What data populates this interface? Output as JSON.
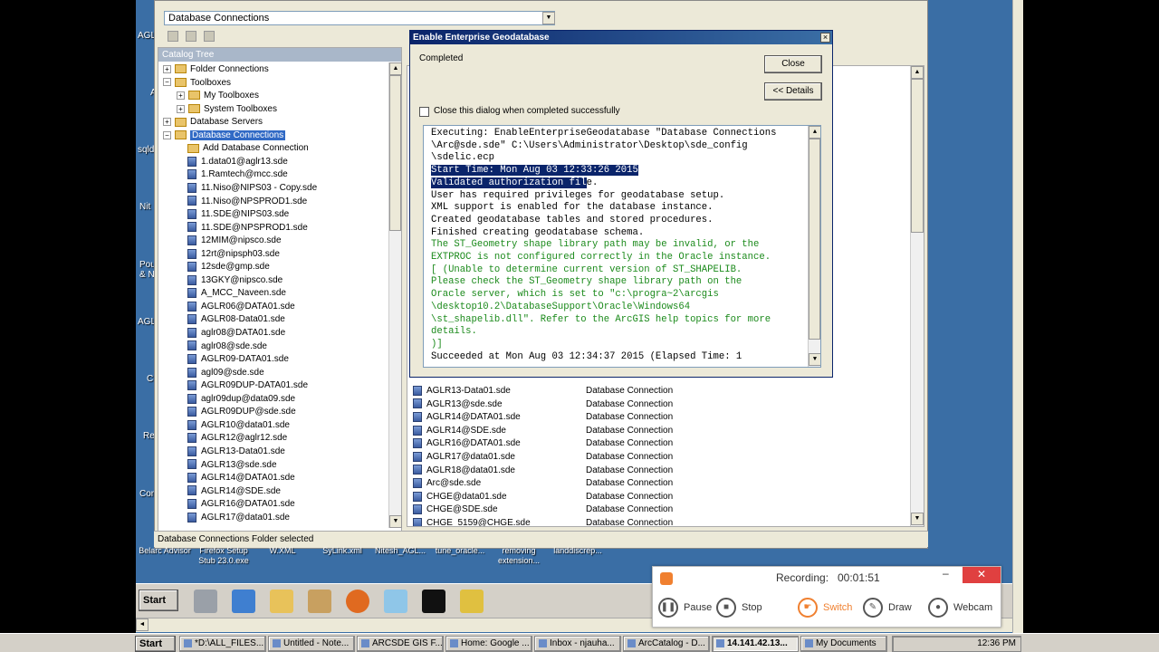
{
  "combo": {
    "location": "Database Connections"
  },
  "desktop_left_labels": [
    "AGL",
    "A",
    "sqld",
    "Nit",
    "Pou",
    "& N",
    "AGL",
    "C",
    "Re",
    "Con"
  ],
  "catalog_tree": {
    "title": "Catalog Tree",
    "nodes": [
      {
        "label": "Folder Connections",
        "level": 0,
        "expander": "+",
        "icon": "folder-icon"
      },
      {
        "label": "Toolboxes",
        "level": 0,
        "expander": "−",
        "icon": "toolbox-icon"
      },
      {
        "label": "My Toolboxes",
        "level": 1,
        "expander": "+",
        "icon": "toolbox-icon"
      },
      {
        "label": "System Toolboxes",
        "level": 1,
        "expander": "+",
        "icon": "toolbox-icon"
      },
      {
        "label": "Database Servers",
        "level": 0,
        "expander": "+",
        "icon": "server-icon"
      },
      {
        "label": "Database Connections",
        "level": 0,
        "expander": "−",
        "icon": "folder-icon",
        "selected": true
      },
      {
        "label": "Add Database Connection",
        "level": 1,
        "icon": "add-connection-icon"
      },
      {
        "label": "1.data01@aglr13.sde",
        "level": 1,
        "icon": "database-icon"
      },
      {
        "label": "1.Ramtech@mcc.sde",
        "level": 1,
        "icon": "database-icon"
      },
      {
        "label": "11.Niso@NIPS03 - Copy.sde",
        "level": 1,
        "icon": "database-icon"
      },
      {
        "label": "11.Niso@NPSPROD1.sde",
        "level": 1,
        "icon": "database-icon"
      },
      {
        "label": "11.SDE@NIPS03.sde",
        "level": 1,
        "icon": "database-icon"
      },
      {
        "label": "11.SDE@NPSPROD1.sde",
        "level": 1,
        "icon": "database-icon"
      },
      {
        "label": "12MIM@nipsco.sde",
        "level": 1,
        "icon": "database-icon"
      },
      {
        "label": "12rt@nipsph03.sde",
        "level": 1,
        "icon": "database-icon"
      },
      {
        "label": "12sde@gmp.sde",
        "level": 1,
        "icon": "database-icon"
      },
      {
        "label": "13GKY@nipsco.sde",
        "level": 1,
        "icon": "database-icon"
      },
      {
        "label": "A_MCC_Naveen.sde",
        "level": 1,
        "icon": "database-icon"
      },
      {
        "label": "AGLR06@DATA01.sde",
        "level": 1,
        "icon": "database-icon"
      },
      {
        "label": "AGLR08-Data01.sde",
        "level": 1,
        "icon": "database-icon"
      },
      {
        "label": "aglr08@DATA01.sde",
        "level": 1,
        "icon": "database-icon"
      },
      {
        "label": "aglr08@sde.sde",
        "level": 1,
        "icon": "database-icon"
      },
      {
        "label": "AGLR09-DATA01.sde",
        "level": 1,
        "icon": "database-icon"
      },
      {
        "label": "agl09@sde.sde",
        "level": 1,
        "icon": "database-icon"
      },
      {
        "label": "AGLR09DUP-DATA01.sde",
        "level": 1,
        "icon": "database-icon"
      },
      {
        "label": "aglr09dup@data09.sde",
        "level": 1,
        "icon": "database-icon"
      },
      {
        "label": "AGLR09DUP@sde.sde",
        "level": 1,
        "icon": "database-icon"
      },
      {
        "label": "AGLR10@data01.sde",
        "level": 1,
        "icon": "database-icon"
      },
      {
        "label": "AGLR12@aglr12.sde",
        "level": 1,
        "icon": "database-icon"
      },
      {
        "label": "AGLR13-Data01.sde",
        "level": 1,
        "icon": "database-icon"
      },
      {
        "label": "AGLR13@sde.sde",
        "level": 1,
        "icon": "database-icon"
      },
      {
        "label": "AGLR14@DATA01.sde",
        "level": 1,
        "icon": "database-icon"
      },
      {
        "label": "AGLR14@SDE.sde",
        "level": 1,
        "icon": "database-icon"
      },
      {
        "label": "AGLR16@DATA01.sde",
        "level": 1,
        "icon": "database-icon"
      },
      {
        "label": "AGLR17@data01.sde",
        "level": 1,
        "icon": "database-icon"
      }
    ]
  },
  "contents": {
    "type_value": "Database Connection",
    "rows": [
      {
        "name": "AGLR13-Data01.sde",
        "type": "Database Connection"
      },
      {
        "name": "AGLR13@sde.sde",
        "type": "Database Connection"
      },
      {
        "name": "AGLR14@DATA01.sde",
        "type": "Database Connection"
      },
      {
        "name": "AGLR14@SDE.sde",
        "type": "Database Connection"
      },
      {
        "name": "AGLR16@DATA01.sde",
        "type": "Database Connection"
      },
      {
        "name": "AGLR17@data01.sde",
        "type": "Database Connection"
      },
      {
        "name": "AGLR18@data01.sde",
        "type": "Database Connection"
      },
      {
        "name": "Arc@sde.sde",
        "type": "Database Connection"
      },
      {
        "name": "CHGE@data01.sde",
        "type": "Database Connection"
      },
      {
        "name": "CHGE@SDE.sde",
        "type": "Database Connection"
      },
      {
        "name": "CHGE_5159@CHGE.sde",
        "type": "Database Connection"
      }
    ]
  },
  "status_bar": {
    "text": "Database Connections Folder selected"
  },
  "dialog": {
    "title": "Enable Enterprise Geodatabase",
    "status": "Completed",
    "close_label": "Close",
    "details_label": "<< Details",
    "checkbox_label": "Close this dialog when completed successfully",
    "log": [
      {
        "t": "Executing: EnableEnterpriseGeodatabase \"Database Connections",
        "kind": "normal"
      },
      {
        "t": "\\Arc@sde.sde\" C:\\Users\\Administrator\\Desktop\\sde_config",
        "kind": "normal"
      },
      {
        "t": "\\sdelic.ecp",
        "kind": "normal"
      },
      {
        "t": "Start Time: Mon Aug 03 12:33:26 2015",
        "kind": "highlight"
      },
      {
        "t": "Validated authorization file.",
        "kind": "highlight-partial",
        "hl": "Validated authorization fil",
        "rest": "e."
      },
      {
        "t": "User has required privileges for geodatabase setup.",
        "kind": "normal"
      },
      {
        "t": "XML support is enabled for the database instance.",
        "kind": "normal"
      },
      {
        "t": "Created geodatabase tables and stored procedures.",
        "kind": "normal"
      },
      {
        "t": "Finished creating geodatabase schema.",
        "kind": "normal"
      },
      {
        "t": "The ST_Geometry shape library path may be invalid, or the",
        "kind": "warn"
      },
      {
        "t": "EXTPROC is not configured correctly in the Oracle instance.",
        "kind": "warn"
      },
      {
        "t": "[ (Unable to determine current version of ST_SHAPELIB.",
        "kind": "warn"
      },
      {
        "t": "Please check the ST_Geometry shape library path on the",
        "kind": "warn"
      },
      {
        "t": "Oracle server, which is set to \"c:\\progra~2\\arcgis",
        "kind": "warn"
      },
      {
        "t": "\\desktop10.2\\DatabaseSupport\\Oracle\\Windows64",
        "kind": "warn"
      },
      {
        "t": "\\st_shapelib.dll\". Refer to the ArcGIS help topics for more",
        "kind": "warn"
      },
      {
        "t": "details.",
        "kind": "warn"
      },
      {
        "t": ")]",
        "kind": "warn"
      },
      {
        "t": "Succeeded at Mon Aug 03 12:34:37 2015 (Elapsed Time: 1",
        "kind": "normal"
      }
    ]
  },
  "desktop_icons": [
    "Belarc Advisor",
    "Firefox Setup Stub 23.0.exe",
    "W.XML",
    "SyLink.xml",
    "Nitesh_AGL...",
    "tune_oracle...",
    "removing extension...",
    "landdiscrep..."
  ],
  "recorder": {
    "status": "Recording:",
    "time": "00:01:51",
    "pause": "Pause",
    "stop": "Stop",
    "switch": "Switch",
    "draw": "Draw",
    "webcam": "Webcam"
  },
  "inner_taskbar": {
    "start_label": "Start"
  },
  "taskbar": {
    "start_label": "Start",
    "items": [
      {
        "label": "*D:\\ALL_FILES...",
        "active": false
      },
      {
        "label": "Untitled - Note...",
        "active": false
      },
      {
        "label": "ARCSDE GIS F...",
        "active": false
      },
      {
        "label": "Home: Google ...",
        "active": false
      },
      {
        "label": "Inbox - njauha...",
        "active": false
      },
      {
        "label": "ArcCatalog - D...",
        "active": false
      },
      {
        "label": "14.141.42.13...",
        "active": true
      },
      {
        "label": "My Documents",
        "active": false
      }
    ],
    "clock": "12:36 PM"
  },
  "colors": {
    "desktop": "#3a6ea5",
    "selection": "#316ac5",
    "warn_text": "#1b8a1b",
    "title_bar": "#0a246a",
    "recorder_accent": "#f08030"
  }
}
